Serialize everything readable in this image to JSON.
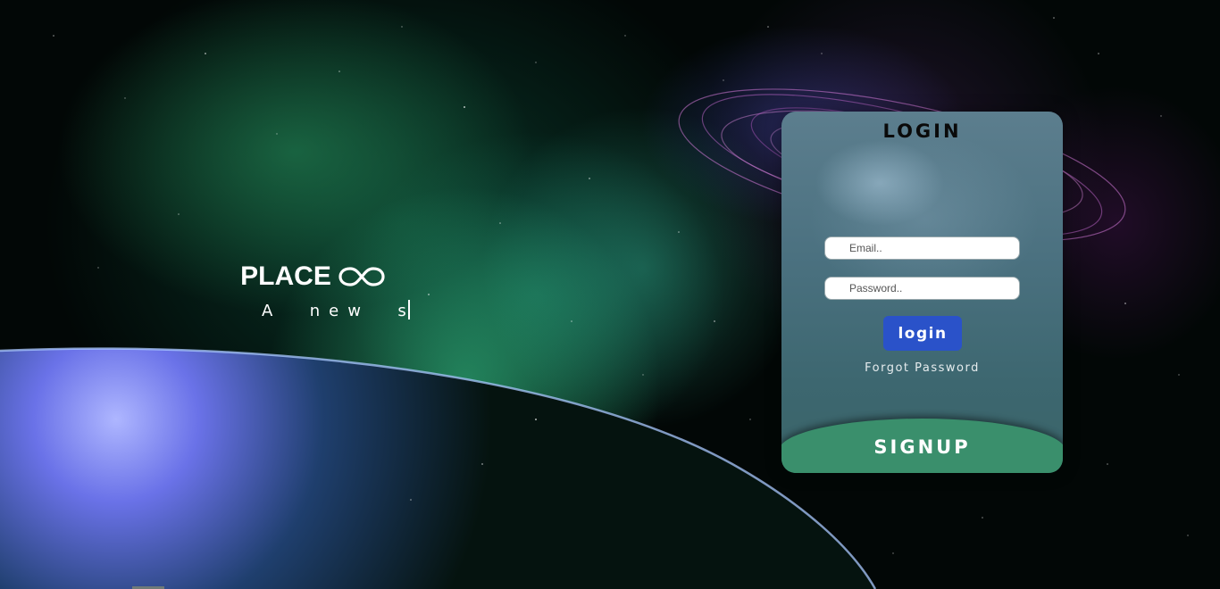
{
  "brand": {
    "title": "PLACE",
    "logo_icon": "infinity-icon",
    "tagline": "A  new  s"
  },
  "login_card": {
    "title": "LOGIN",
    "email_placeholder": "Email..",
    "password_placeholder": "Password..",
    "login_label": "login",
    "forgot_label": "Forgot Password",
    "signup_label": "SIGNUP"
  },
  "colors": {
    "login_button": "#2a52c9",
    "signup_band": "#3a8f6c",
    "card_top": "#5c7e8e",
    "card_bottom": "#3a6468"
  }
}
